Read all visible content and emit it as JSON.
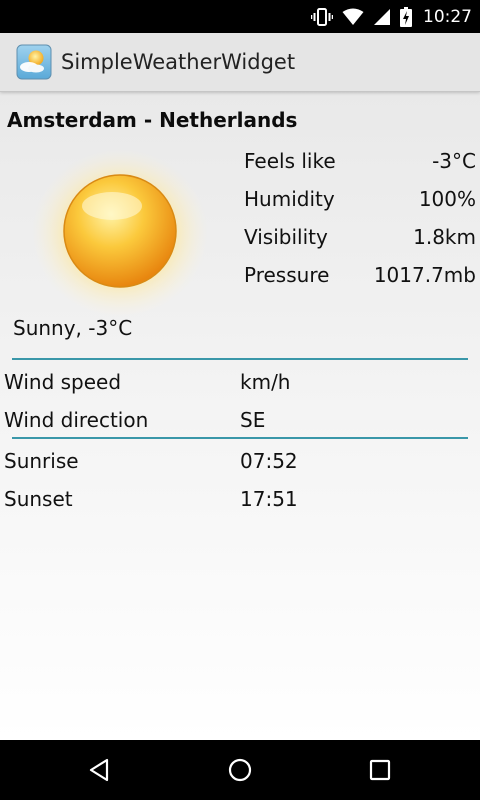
{
  "status_bar": {
    "time": "10:27",
    "icons": [
      "vibrate-icon",
      "wifi-icon",
      "signal-icon",
      "battery-charging-icon"
    ]
  },
  "action_bar": {
    "app_title": "SimpleWeatherWidget",
    "icon": "weather-app-icon"
  },
  "weather": {
    "location": "Amsterdam - Netherlands",
    "condition": "Sunny, -3°C",
    "icon": "sun-icon",
    "stats": [
      {
        "label": "Feels like",
        "value": "-3°C"
      },
      {
        "label": "Humidity",
        "value": "100%"
      },
      {
        "label": "Visibility",
        "value": "1.8km"
      },
      {
        "label": "Pressure",
        "value": "1017.7mb"
      }
    ],
    "wind": [
      {
        "label": "Wind speed",
        "value": "km/h"
      },
      {
        "label": "Wind direction",
        "value": "SE"
      }
    ],
    "sun_times": [
      {
        "label": "Sunrise",
        "value": "07:52"
      },
      {
        "label": "Sunset",
        "value": "17:51"
      }
    ]
  },
  "nav_bar": {
    "buttons": [
      "back-icon",
      "home-icon",
      "recents-icon"
    ]
  },
  "colors": {
    "divider": "#3a97a9",
    "status_bar": "#000000",
    "action_bar": "#e5e5e5"
  }
}
